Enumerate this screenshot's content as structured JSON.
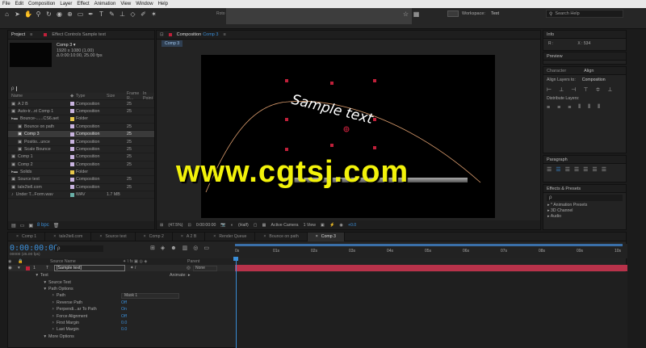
{
  "menu": [
    "File",
    "Edit",
    "Composition",
    "Layer",
    "Effect",
    "Animation",
    "View",
    "Window",
    "Help"
  ],
  "toolbar": {
    "workspace_label": "Workspace:",
    "workspace_value": "Text",
    "search_placeholder": "Search Help",
    "rotobrush_hint": "Roto"
  },
  "project_panel": {
    "tab_project": "Project",
    "tab_effect_controls": "Effect Controls Sample text",
    "selected_item": "Comp 3 ▾",
    "selected_info": [
      "1920 x 1080 (1.00)",
      "Δ 0:00:10:00, 25.00 fps"
    ],
    "search_placeholder": "ρ",
    "columns": [
      "Name",
      "Type",
      "Size",
      "Frame R...",
      "In Point"
    ],
    "items": [
      {
        "name": "A 2 B",
        "type": "Composition",
        "size": "",
        "fr": "25",
        "color": "#c9b4e0",
        "indent": 0,
        "icon": "comp"
      },
      {
        "name": "Auto-tr...xt Comp 1",
        "type": "Composition",
        "size": "",
        "fr": "25",
        "color": "#c9b4e0",
        "indent": 0,
        "icon": "comp"
      },
      {
        "name": "Bounce-......CS6.aet",
        "type": "Folder",
        "size": "",
        "fr": "",
        "color": "#e8c84a",
        "indent": 0,
        "icon": "folder"
      },
      {
        "name": "Bounce on path",
        "type": "Composition",
        "size": "",
        "fr": "25",
        "color": "#c9b4e0",
        "indent": 1,
        "icon": "comp"
      },
      {
        "name": "Comp 3",
        "type": "Composition",
        "size": "",
        "fr": "25",
        "color": "#c9b4e0",
        "indent": 1,
        "icon": "comp",
        "selected": true
      },
      {
        "name": "Positio...unce",
        "type": "Composition",
        "size": "",
        "fr": "25",
        "color": "#c9b4e0",
        "indent": 1,
        "icon": "comp"
      },
      {
        "name": "Scale Bounce",
        "type": "Composition",
        "size": "",
        "fr": "25",
        "color": "#c9b4e0",
        "indent": 1,
        "icon": "comp"
      },
      {
        "name": "Comp 1",
        "type": "Composition",
        "size": "",
        "fr": "25",
        "color": "#c9b4e0",
        "indent": 0,
        "icon": "comp"
      },
      {
        "name": "Comp 2",
        "type": "Composition",
        "size": "",
        "fr": "25",
        "color": "#c9b4e0",
        "indent": 0,
        "icon": "comp"
      },
      {
        "name": "Solids",
        "type": "Folder",
        "size": "",
        "fr": "",
        "color": "#e8c84a",
        "indent": 0,
        "icon": "folder"
      },
      {
        "name": "Source text",
        "type": "Composition",
        "size": "",
        "fr": "25",
        "color": "#c9b4e0",
        "indent": 0,
        "icon": "comp"
      },
      {
        "name": "tale2tell.com",
        "type": "Composition",
        "size": "",
        "fr": "25",
        "color": "#c9b4e0",
        "indent": 0,
        "icon": "comp"
      },
      {
        "name": "Under T...Form.wav",
        "type": "WAV",
        "size": "1.7 MB",
        "fr": "",
        "color": "#6ab0a8",
        "indent": 0,
        "icon": "audio"
      }
    ],
    "footer_bpc": "8 bpc"
  },
  "composition_panel": {
    "tab_label": "Composition",
    "tab_comp": "Comp 3",
    "sub_tab": "Comp 3",
    "path_text": "Sample text",
    "footer": {
      "zoom": "(47.5%)",
      "timecode": "0:00:00:00",
      "resolution": "(Half)",
      "camera": "Active Camera",
      "view": "1 View",
      "exposure": "+0.0"
    }
  },
  "right_panels": {
    "info_tab": "Info",
    "info_r": "R :",
    "info_x": "X : 534",
    "preview_tab": "Preview",
    "character_tab": "Character",
    "align_tab": "Align",
    "align_layers_to": "Align Layers to:",
    "align_target": "Composition",
    "distribute_layers": "Distribute Layers:",
    "paragraph_tab": "Paragraph",
    "effects_tab": "Effects & Presets",
    "effects_search": "ρ",
    "effects_items": [
      "* Animation Presets",
      "3D Channel",
      "Audio"
    ]
  },
  "timeline": {
    "tabs": [
      {
        "label": "Comp 1",
        "active": false
      },
      {
        "label": "tale2tell.com",
        "active": false
      },
      {
        "label": "Source text",
        "active": false
      },
      {
        "label": "Comp 2",
        "active": false
      },
      {
        "label": "A 2 B",
        "active": false
      },
      {
        "label": "Render Queue",
        "active": false
      },
      {
        "label": "Bounce on path",
        "active": false
      },
      {
        "label": "Comp 3",
        "active": true
      }
    ],
    "timecode": "0:00:00:00",
    "fps_info": "00000 (25.00 fps)",
    "search_placeholder": "ρ",
    "col_source_name": "Source Name",
    "col_parent": "Parent",
    "ruler": [
      "0s",
      "01s",
      "02s",
      "03s",
      "04s",
      "05s",
      "06s",
      "07s",
      "08s",
      "09s",
      "10s"
    ],
    "layer": {
      "index": "1",
      "name": "[Sample text]",
      "parent": "None"
    },
    "props": [
      {
        "label": "Text",
        "value": "",
        "indent": 1,
        "extra": "Animate:"
      },
      {
        "label": "Source Text",
        "value": "",
        "indent": 2
      },
      {
        "label": "Path Options",
        "value": "",
        "indent": 2
      },
      {
        "label": "Path",
        "value": "Mask 1",
        "indent": 3,
        "dropdown": true
      },
      {
        "label": "Reverse Path",
        "value": "Off",
        "indent": 3
      },
      {
        "label": "Perpendi...ar To Path",
        "value": "On",
        "indent": 3
      },
      {
        "label": "Force Alignment",
        "value": "Off",
        "indent": 3
      },
      {
        "label": "First Margin",
        "value": "0.0",
        "indent": 3
      },
      {
        "label": "Last Margin",
        "value": "0.0",
        "indent": 3
      },
      {
        "label": "More Options",
        "value": "",
        "indent": 2
      }
    ]
  },
  "watermark": "www.cgtsj.com",
  "colors": {
    "accent_blue": "#3a8ed8",
    "track_red": "#b8324a",
    "path_orange": "#e0a070"
  }
}
